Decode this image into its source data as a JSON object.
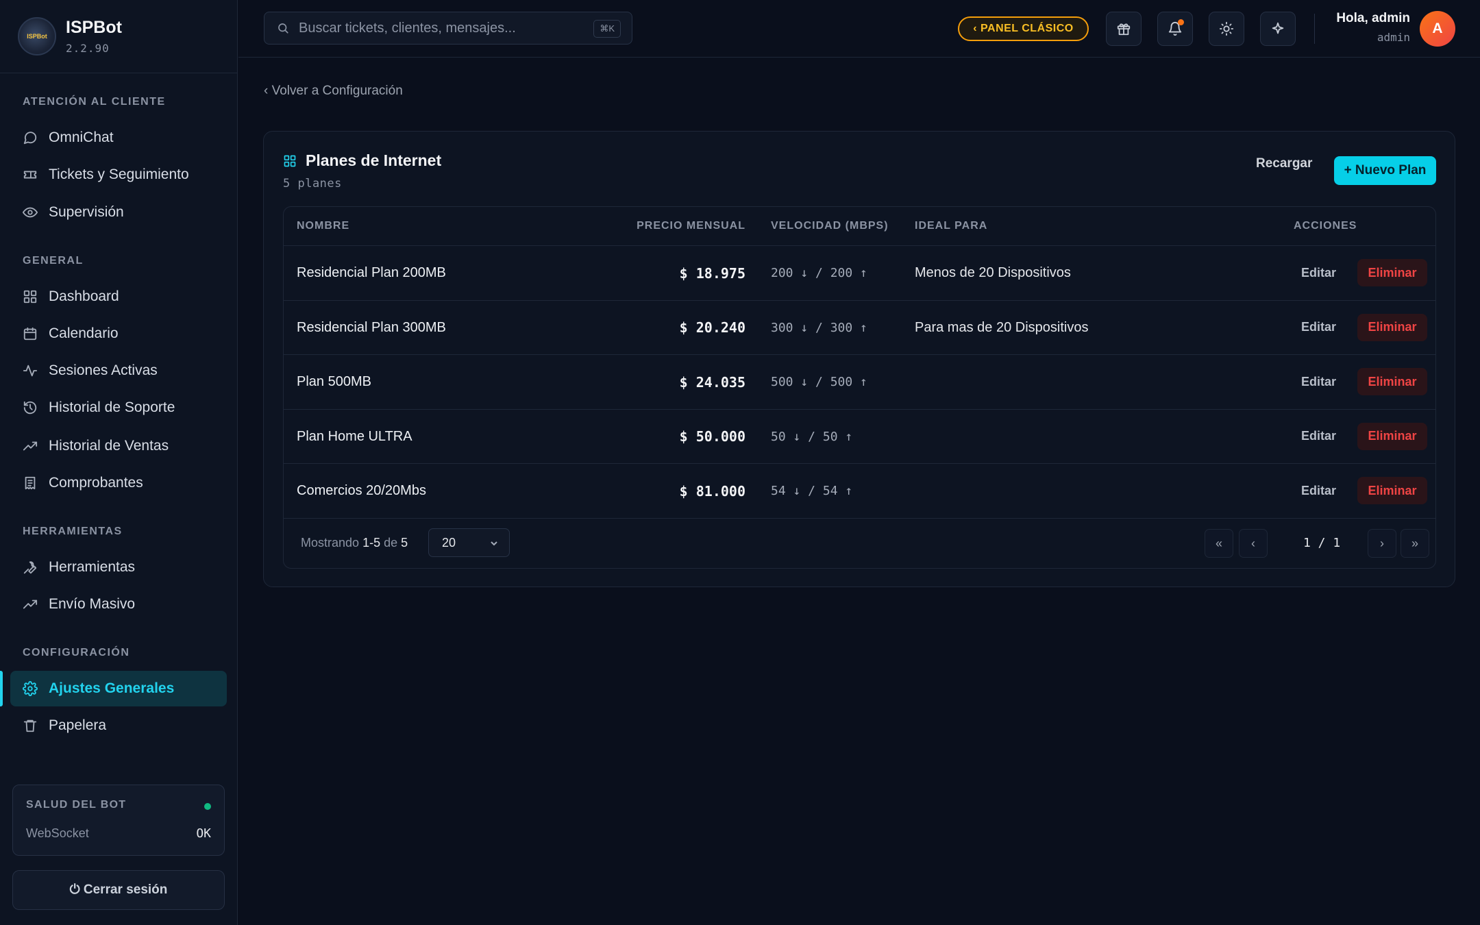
{
  "brand": {
    "name": "ISPBot",
    "version": "2.2.90",
    "logo_text": "ISPBot"
  },
  "sidebar": {
    "sections": [
      {
        "title": "ATENCIÓN AL CLIENTE",
        "items": [
          {
            "label": "OmniChat",
            "icon": "chat-icon"
          },
          {
            "label": "Tickets y Seguimiento",
            "icon": "ticket-icon"
          },
          {
            "label": "Supervisión",
            "icon": "eye-icon"
          }
        ]
      },
      {
        "title": "GENERAL",
        "items": [
          {
            "label": "Dashboard",
            "icon": "grid-icon"
          },
          {
            "label": "Calendario",
            "icon": "calendar-icon"
          },
          {
            "label": "Sesiones Activas",
            "icon": "activity-icon"
          },
          {
            "label": "Historial de Soporte",
            "icon": "history-icon"
          },
          {
            "label": "Historial de Ventas",
            "icon": "trending-up-icon"
          },
          {
            "label": "Comprobantes",
            "icon": "receipt-icon"
          }
        ]
      },
      {
        "title": "HERRAMIENTAS",
        "items": [
          {
            "label": "Herramientas",
            "icon": "wrench-icon"
          },
          {
            "label": "Envío Masivo",
            "icon": "trending-up-icon"
          }
        ]
      },
      {
        "title": "CONFIGURACIÓN",
        "items": [
          {
            "label": "Ajustes Generales",
            "icon": "gear-icon",
            "active": true
          },
          {
            "label": "Papelera",
            "icon": "trash-icon"
          }
        ]
      }
    ],
    "health": {
      "title": "SALUD DEL BOT",
      "label": "WebSocket",
      "status": "OK",
      "status_color": "#10b981"
    },
    "logout_label": "⏻ Cerrar sesión"
  },
  "header": {
    "search_placeholder": "Buscar tickets, clientes, mensajes...",
    "search_shortcut": "⌘K",
    "classic_panel_label": "‹ PANEL CLÁSICO",
    "greeting": "Hola, admin",
    "role": "admin",
    "avatar_initial": "A"
  },
  "main": {
    "back_link": "‹ Volver a Configuración",
    "card_title": "Planes de Internet",
    "card_subtitle": "5 planes",
    "reload_label": "Recargar",
    "new_plan_label": "+ Nuevo Plan",
    "columns": {
      "name": "NOMBRE",
      "price": "PRECIO MENSUAL",
      "speed": "VELOCIDAD (MBPS)",
      "ideal": "IDEAL PARA",
      "actions": "ACCIONES"
    },
    "rows": [
      {
        "name": "Residencial Plan 200MB",
        "price": "$ 18.975",
        "speed": "200 ↓ / 200 ↑",
        "ideal": "Menos de 20 Dispositivos"
      },
      {
        "name": "Residencial Plan 300MB",
        "price": "$ 20.240",
        "speed": "300 ↓ / 300 ↑",
        "ideal": "Para mas de 20 Dispositivos"
      },
      {
        "name": "Plan 500MB",
        "price": "$ 24.035",
        "speed": "500 ↓ / 500 ↑",
        "ideal": ""
      },
      {
        "name": "Plan Home ULTRA",
        "price": "$ 50.000",
        "speed": "50 ↓ / 50 ↑",
        "ideal": ""
      },
      {
        "name": "Comercios 20/20Mbs",
        "price": "$ 81.000",
        "speed": "54 ↓ / 54 ↑",
        "ideal": ""
      }
    ],
    "edit_label": "Editar",
    "delete_label": "Eliminar",
    "footer": {
      "showing_prefix": "Mostrando",
      "range": "1-5",
      "of": "de",
      "total": "5",
      "per_page": "20",
      "page_info": "1 / 1",
      "first": "«",
      "prev": "‹",
      "next": "›",
      "last": "»"
    }
  },
  "colors": {
    "accent": "#22d3ee",
    "danger": "#ef4444",
    "warning": "#f59e0b",
    "background": "#0a0f1c"
  }
}
